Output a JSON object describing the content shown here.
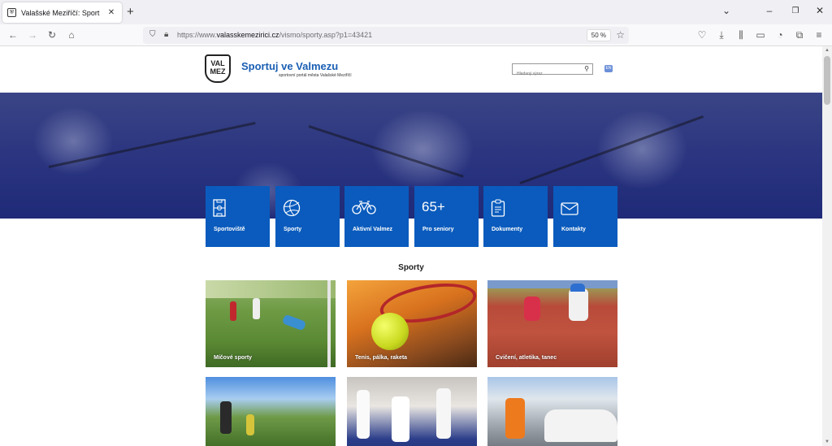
{
  "browser": {
    "tab_title": "Valašské Meziříčí: Sport",
    "tab_close": "✕",
    "new_tab": "+",
    "url_prefix": "https://www.",
    "url_domain": "valasskemezirici.cz",
    "url_path": "/vismo/sporty.asp?p1=43421",
    "zoom": "50 %"
  },
  "site": {
    "logo_text": "VAL MEZ",
    "title": "Sportuj ve Valmezu",
    "subtitle": "sportovní portál města Valašské Meziříčí",
    "search_placeholder": "Hledaný výraz",
    "lang": "EN"
  },
  "tiles": [
    {
      "label": "Sportoviště",
      "icon": "field-icon"
    },
    {
      "label": "Sporty",
      "icon": "ball-icon"
    },
    {
      "label": "Aktivní Valmez",
      "icon": "bicycle-icon"
    },
    {
      "label": "Pro seniory",
      "icon": "65plus-icon",
      "icon_text": "65+"
    },
    {
      "label": "Dokumenty",
      "icon": "clipboard-icon"
    },
    {
      "label": "Kontakty",
      "icon": "envelope-icon"
    }
  ],
  "section_title": "Sporty",
  "cards": [
    {
      "label": "Míčové sporty"
    },
    {
      "label": "Tenis, pálka, raketa"
    },
    {
      "label": "Cvičení, atletika, tanec"
    }
  ],
  "colors": {
    "brand_blue": "#0a5bbd",
    "title_blue": "#1a5fb4",
    "hero_navy": "#2b3580"
  }
}
